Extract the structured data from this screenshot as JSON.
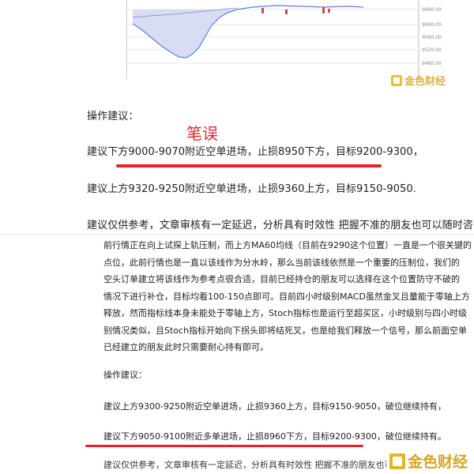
{
  "chart": {
    "price_labels": [
      "9680.00",
      "9600.00",
      "9560.00",
      "9520.00",
      "9480.00"
    ],
    "colors": {
      "price_line": "#5b7fe0",
      "fill": "#d9ddf4",
      "candle": "#c0504d",
      "grid": "#e6e6e6"
    }
  },
  "watermark": {
    "text": "金色财经",
    "color": "#d6a521"
  },
  "upper": {
    "title": "操作建议：",
    "annotation": "笔误",
    "line1": "建议下方9000-9070附近空单进场，止损8950下方，目标9200-9300，",
    "line2": "建议上方9320-9250附近空单进场，止损9360上方，目标9150-9050.",
    "line3": "建议仅供参考，文章审核有一定延迟，分析具有时效性 把握不准的朋友也可以随时咨询小"
  },
  "lower": {
    "paragraph": [
      "前行情正在向上试探上轨压制，而上方MA60均线（目前在9290这个位置）一直是一个很关键的",
      "点位，此前行情也是一直以该线作为分水岭，那么当前该线依然是一个重要的压制位，我们的",
      "空头订单建立将该线作为参考点很合适，目前已经持仓的朋友可以选择在这个位置防守不破的",
      "情况下进行补仓，目标均看100-150点即可。目前四小时级别MACD虽然金叉且量能于零轴上方",
      "释放，然而指标线本身未能处于零轴上方，Stoch指标也是运行至超买区，小时级别与四小时级",
      "别情况类似，且Stoch指标开始向下拐头即将结死叉，也是给我们释放一个信号，那么前面空单",
      "已经建立的朋友此时只需要耐心持有即可。"
    ],
    "title": "操作建议：",
    "line1": "建议上方9300-9250附近空单进场，止损9360上方，目标9150-9050，破位继续持有，",
    "line2": "建议下方9050-9100附近多单进场，止损8960下方，目标9200-9300，破位继续持有。",
    "line3": "建议仅供参考，文章审核有一定延迟，分析具有时效性 把握不准的朋友也可以随时咨询"
  },
  "annotation_color": "#e5242b"
}
